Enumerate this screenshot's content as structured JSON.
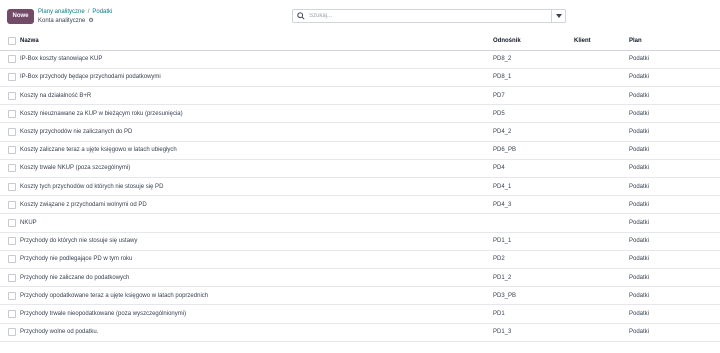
{
  "toolbar": {
    "new_button": "Nowe"
  },
  "breadcrumb": {
    "parent": "Plany analityczne",
    "current": "Podatki",
    "separator": "/"
  },
  "subtitle": "Konta analityczne",
  "search": {
    "placeholder": "Szukaj..."
  },
  "table": {
    "headers": {
      "name": "Nazwa",
      "ref": "Odnośnik",
      "client": "Klient",
      "plan": "Plan"
    },
    "rows": [
      {
        "name": "IP-Box koszty stanowiące KUP",
        "ref": "PD8_2",
        "client": "",
        "plan": "Podatki"
      },
      {
        "name": "IP-Box przychody będące przychodami podatkowymi",
        "ref": "PD8_1",
        "client": "",
        "plan": "Podatki"
      },
      {
        "name": "Koszty na działalność B+R",
        "ref": "PD7",
        "client": "",
        "plan": "Podatki"
      },
      {
        "name": "Koszty nieuznawane za KUP w bieżącym roku (przesunięcia)",
        "ref": "PD5",
        "client": "",
        "plan": "Podatki"
      },
      {
        "name": "Koszty przychodów nie zaliczanych do PD",
        "ref": "PD4_2",
        "client": "",
        "plan": "Podatki"
      },
      {
        "name": "Koszty zaliczane teraz a ujęte księgowo w latach ubiegłych",
        "ref": "PD6_PB",
        "client": "",
        "plan": "Podatki"
      },
      {
        "name": "Koszty trwale NKUP (poza szczególnymi)",
        "ref": "PD4",
        "client": "",
        "plan": "Podatki"
      },
      {
        "name": "Koszty tych przychodów od których nie stosuje się PD",
        "ref": "PD4_1",
        "client": "",
        "plan": "Podatki"
      },
      {
        "name": "Koszty związane z przychodami wolnymi od PD",
        "ref": "PD4_3",
        "client": "",
        "plan": "Podatki"
      },
      {
        "name": "NKUP",
        "ref": "",
        "client": "",
        "plan": "Podatki"
      },
      {
        "name": "Przychody do których nie stosuje się ustawy",
        "ref": "PD1_1",
        "client": "",
        "plan": "Podatki"
      },
      {
        "name": "Przychody nie podlegające PD w tym roku",
        "ref": "PD2",
        "client": "",
        "plan": "Podatki"
      },
      {
        "name": "Przychody nie zaliczane do podatkowych",
        "ref": "PD1_2",
        "client": "",
        "plan": "Podatki"
      },
      {
        "name": "Przychody opodatkowane teraz a ujęte księgowo w latach poprzednich",
        "ref": "PD3_PB",
        "client": "",
        "plan": "Podatki"
      },
      {
        "name": "Przychody trwale nieopodatkowane (poza wyszczególnionymi)",
        "ref": "PD1",
        "client": "",
        "plan": "Podatki"
      },
      {
        "name": "Przychody wolne od podatku.",
        "ref": "PD1_3",
        "client": "",
        "plan": "Podatki"
      }
    ]
  }
}
